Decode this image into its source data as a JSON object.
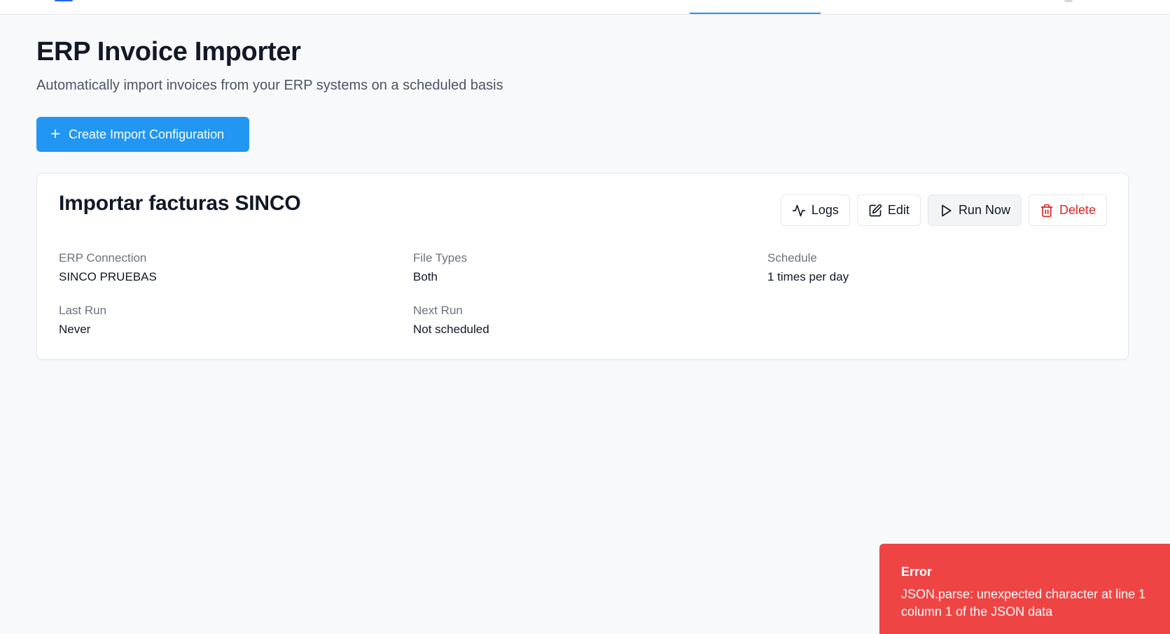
{
  "header": {
    "logo_icon": "app-logo-icon",
    "avatar_icon": "user-avatar-icon"
  },
  "page": {
    "title": "ERP Invoice Importer",
    "subtitle": "Automatically import invoices from your ERP systems on a scheduled basis"
  },
  "actions": {
    "create_label": "Create Import Configuration",
    "create_icon": "plus-icon"
  },
  "config_card": {
    "title": "Importar facturas SINCO",
    "buttons": {
      "logs": "Logs",
      "edit": "Edit",
      "run_now": "Run Now",
      "delete": "Delete"
    },
    "fields": {
      "erp_connection": {
        "label": "ERP Connection",
        "value": "SINCO PRUEBAS"
      },
      "file_types": {
        "label": "File Types",
        "value": "Both"
      },
      "schedule": {
        "label": "Schedule",
        "value": "1 times per day"
      },
      "last_run": {
        "label": "Last Run",
        "value": "Never"
      },
      "next_run": {
        "label": "Next Run",
        "value": "Not scheduled"
      }
    }
  },
  "toast": {
    "title": "Error",
    "message": "JSON.parse: unexpected character at line 1 column 1 of the JSON data"
  },
  "colors": {
    "primary": "#2196f3",
    "danger": "#dc2626",
    "toast_bg": "#ef4444",
    "page_bg": "#f8f9fb"
  }
}
